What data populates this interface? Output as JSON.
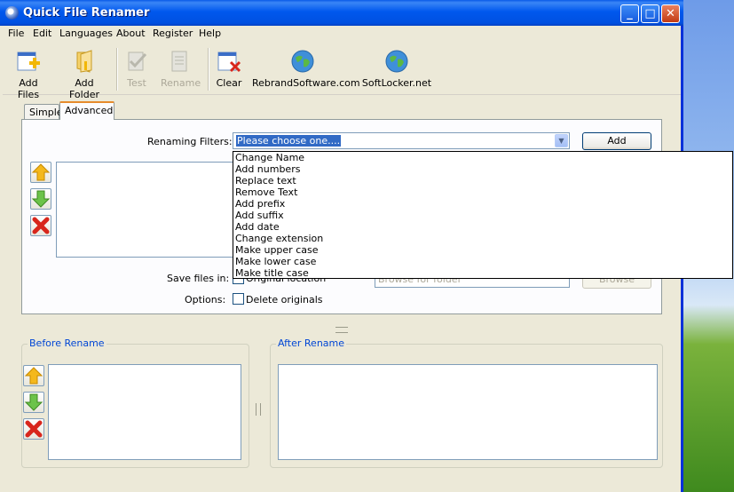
{
  "window": {
    "title": "Quick File Renamer"
  },
  "menu": [
    "File",
    "Edit",
    "Languages",
    "About",
    "Register",
    "Help"
  ],
  "toolbar": [
    {
      "label": "Add Files",
      "icon": "add-files-icon",
      "enabled": true
    },
    {
      "label": "Add Folder",
      "icon": "add-folder-icon",
      "enabled": true
    },
    {
      "label": "Test",
      "icon": "test-icon",
      "enabled": false
    },
    {
      "label": "Rename",
      "icon": "rename-icon",
      "enabled": false
    },
    {
      "label": "Clear",
      "icon": "clear-icon",
      "enabled": true
    },
    {
      "label": "RebrandSoftware.com",
      "icon": "globe-icon",
      "enabled": true
    },
    {
      "label": "SoftLocker.net",
      "icon": "globe-icon",
      "enabled": true
    }
  ],
  "tabs": {
    "simple": "Simple",
    "advanced": "Advanced"
  },
  "advanced": {
    "renaming_filters_label": "Renaming Filters:",
    "combo_selected": "Please choose one....",
    "add_button": "Add",
    "save_files_label": "Save files in:",
    "save_location_option": "Original location",
    "folder_placeholder": "Browse for folder",
    "browse_button": "Browse",
    "options_label": "Options:",
    "delete_originals": "Delete originals"
  },
  "filter_options": [
    "Change Name",
    "Add numbers",
    "Replace text",
    "Remove Text",
    "Add prefix",
    "Add suffix",
    "Add date",
    "Change extension",
    "Make upper case",
    "Make lower case",
    "Make title case"
  ],
  "before_rename": {
    "title": "Before Rename"
  },
  "after_rename": {
    "title": "After Rename"
  }
}
